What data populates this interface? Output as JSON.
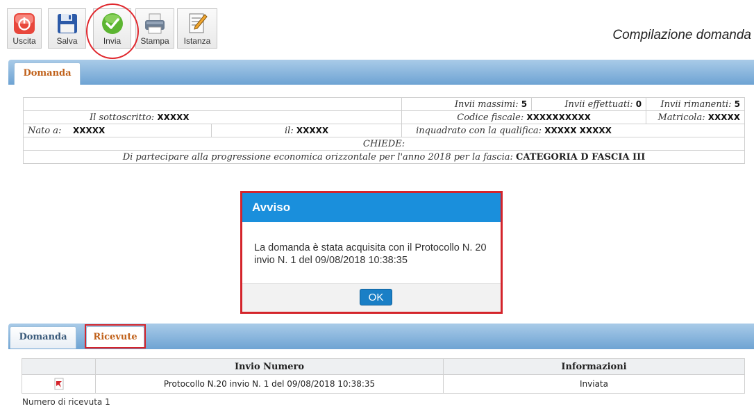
{
  "toolbar": {
    "buttons": [
      {
        "label": "Uscita",
        "icon": "power-icon"
      },
      {
        "label": "Salva",
        "icon": "floppy-disk-icon"
      },
      {
        "label": "Invia",
        "icon": "checkmark-icon"
      },
      {
        "label": "Stampa",
        "icon": "printer-icon"
      },
      {
        "label": "Istanza",
        "icon": "document-edit-icon"
      }
    ]
  },
  "page_title": "Compilazione domanda",
  "top_tabs": [
    {
      "label": "Domanda"
    }
  ],
  "form": {
    "invii_massimi_label": "Invii massimi:",
    "invii_massimi_value": "5",
    "invii_effettuati_label": "Invii effettuati:",
    "invii_effettuati_value": "0",
    "invii_rimanenti_label": "Invii rimanenti:",
    "invii_rimanenti_value": "5",
    "sottoscritto_label": "Il sottoscritto:",
    "sottoscritto_value": "XXXXX",
    "codice_fiscale_label": "Codice fiscale:",
    "codice_fiscale_value": "XXXXXXXXXX",
    "matricola_label": "Matricola:",
    "matricola_value": "XXXXX",
    "nato_label": "Nato a:",
    "nato_value": "XXXXX",
    "il_label": "il:",
    "il_value": "XXXXX",
    "qualifica_label": "inquadrato con la qualifica:",
    "qualifica_value": "XXXXX XXXXX",
    "chiede": "CHIEDE:",
    "partecipare_text": "Di partecipare alla progressione economica orizzontale per l'anno 2018 per la fascia:",
    "fascia_value": "CATEGORIA D FASCIA III"
  },
  "dialog": {
    "title": "Avviso",
    "message": "La domanda è stata acquisita con il Protocollo N. 20 invio N. 1 del 09/08/2018 10:38:35",
    "ok_label": "OK",
    "header_color": "#1a8fdc"
  },
  "bottom_tabs": [
    {
      "label": "Domanda"
    },
    {
      "label": "Ricevute"
    }
  ],
  "receipts": {
    "headers": [
      "",
      "Invio Numero",
      "Informazioni"
    ],
    "rows": [
      {
        "icon": "pdf-icon",
        "invio": "Protocollo N.20 invio N. 1 del 09/08/2018 10:38:35",
        "info": "Inviata"
      }
    ],
    "footer": "Numero di ricevuta 1"
  },
  "colors": {
    "accent": "#1a8fdc",
    "highlight": "#d4242b",
    "active_tab_text": "#c0611a"
  }
}
